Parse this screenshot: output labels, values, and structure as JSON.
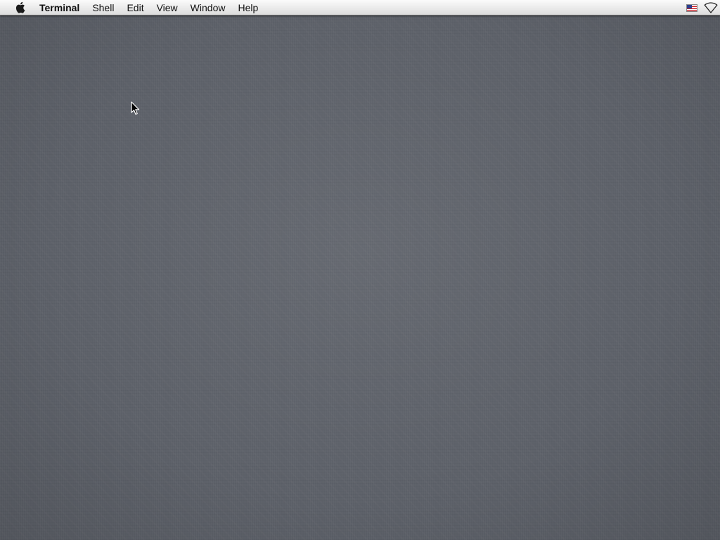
{
  "menubar": {
    "app_name": "Terminal",
    "menus": [
      "Shell",
      "Edit",
      "View",
      "Window",
      "Help"
    ],
    "apple_icon": "apple-logo-icon",
    "status_icons": [
      "us-flag-input-source-icon",
      "wifi-icon"
    ]
  },
  "desktop": {
    "wallpaper": "gray linen",
    "cursor_icon": "arrow-cursor-icon"
  },
  "colors": {
    "menubar": "#ececec",
    "desktop": "#5d6169"
  }
}
